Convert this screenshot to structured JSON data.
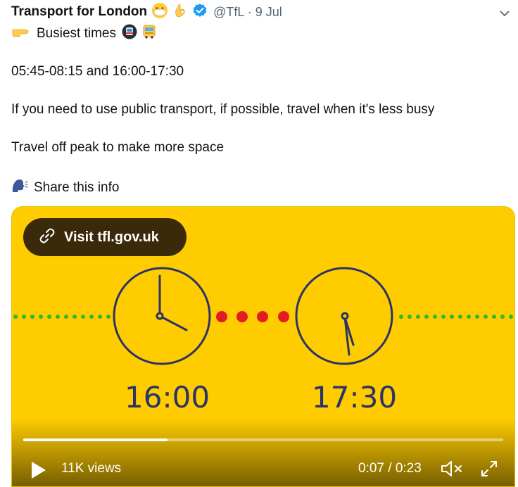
{
  "tweet": {
    "author_name": "Transport for London",
    "handle_date": "@TfL · 9 Jul",
    "lines": [
      "Busiest times",
      "05:45-08:15 and 16:00-17:30",
      "If you need to use public transport, if possible, travel when it's less busy",
      "Travel off peak to make more space",
      "Share this info"
    ],
    "icons": {
      "author_emoji_1": "face-with-mask-icon",
      "author_emoji_2": "ok-hand-icon",
      "verified": "verified-badge-icon",
      "menu": "chevron-down-icon",
      "line1_prefix": "pointing-right-hand-icon",
      "line1_suffix": [
        "metro-train-icon",
        "bus-icon"
      ],
      "line5_prefix": "speaking-head-icon"
    }
  },
  "media": {
    "visit_link_label": "Visit tfl.gov.uk",
    "clock_left_time": "16:00",
    "clock_right_time": "17:30",
    "views_label": "11K views",
    "timecode": "0:07 / 0:23",
    "progress": 0.3,
    "colors": {
      "background": "#FFCC00",
      "clock": "#2a3466",
      "green_dots": "#2db82d",
      "red_dots": "#e31b23"
    }
  }
}
